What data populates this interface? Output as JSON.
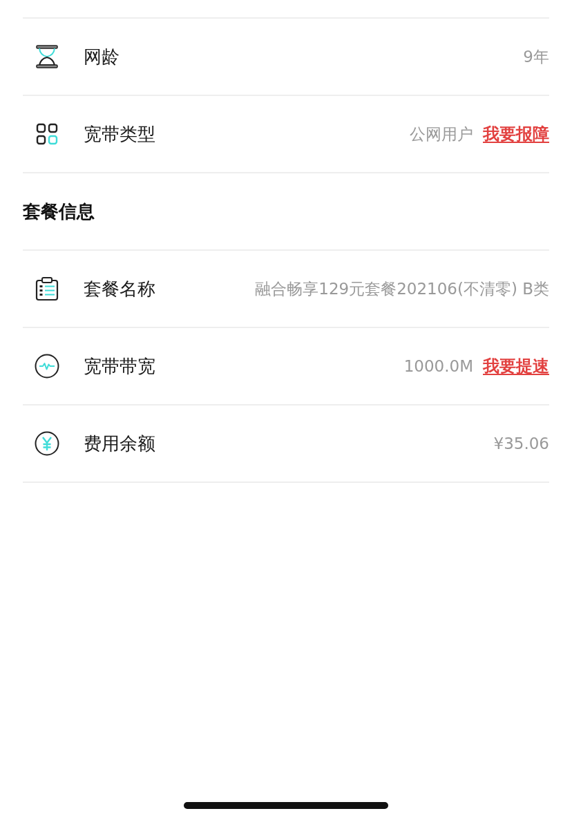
{
  "groups": [
    {
      "rows": [
        {
          "kind": "age",
          "label": "网龄",
          "value": "9年"
        },
        {
          "kind": "type",
          "label": "宽带类型",
          "value": "公网用户",
          "link": "我要报障"
        }
      ]
    },
    {
      "title": "套餐信息",
      "rows": [
        {
          "kind": "plan",
          "label": "套餐名称",
          "value": "融合畅享129元套餐202106(不清零) B类"
        },
        {
          "kind": "speed",
          "label": "宽带带宽",
          "value": "1000.0M",
          "link": "我要提速"
        },
        {
          "kind": "balance",
          "label": "费用余额",
          "value": "¥35.06"
        }
      ]
    }
  ]
}
